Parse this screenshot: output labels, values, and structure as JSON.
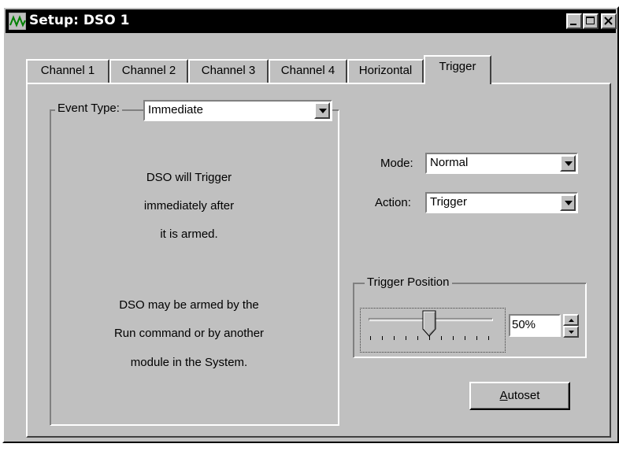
{
  "window": {
    "title": "Setup: DSO 1",
    "app_icon": "waveform-icon",
    "controls": [
      "minimize-icon",
      "maximize-icon",
      "close-icon"
    ]
  },
  "tabs": [
    {
      "label": "Channel 1",
      "active": false
    },
    {
      "label": "Channel 2",
      "active": false
    },
    {
      "label": "Channel 3",
      "active": false
    },
    {
      "label": "Channel 4",
      "active": false
    },
    {
      "label": "Horizontal",
      "active": false
    },
    {
      "label": "Trigger",
      "active": true
    }
  ],
  "event_type": {
    "label": "Event Type:",
    "value": "Immediate",
    "description": [
      "DSO will Trigger",
      "immediately after",
      "it is armed.",
      "DSO may be armed by the",
      "Run command or by another",
      "module in the System."
    ]
  },
  "mode": {
    "label": "Mode:",
    "value": "Normal"
  },
  "action": {
    "label": "Action:",
    "value": "Trigger"
  },
  "trigger_position": {
    "label": "Trigger Position",
    "value_text": "50%",
    "percent": 50,
    "tick_count": 11
  },
  "autoset": {
    "label_first": "A",
    "label_rest": "utoset"
  },
  "colors": {
    "face": "#c0c0c0",
    "titlebar": "#000000",
    "field": "#ffffff"
  }
}
